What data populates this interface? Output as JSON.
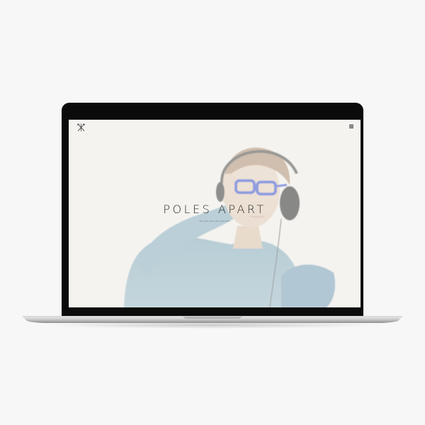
{
  "website": {
    "logo_icon": "crossed-arrows-logo",
    "menu_icon": "hamburger-menu-icon",
    "hero": {
      "title": "POLES APART",
      "tagline": "the way you see yourself"
    }
  },
  "colors": {
    "page_background": "#f7f7f7",
    "bezel": "#0b0b0b",
    "screen_background": "#f4f3ef",
    "title_text": "#2a2a2a",
    "sweater": "#7ea9bd",
    "glasses": "#4a63d6",
    "headphones": "#3a3a3a"
  }
}
